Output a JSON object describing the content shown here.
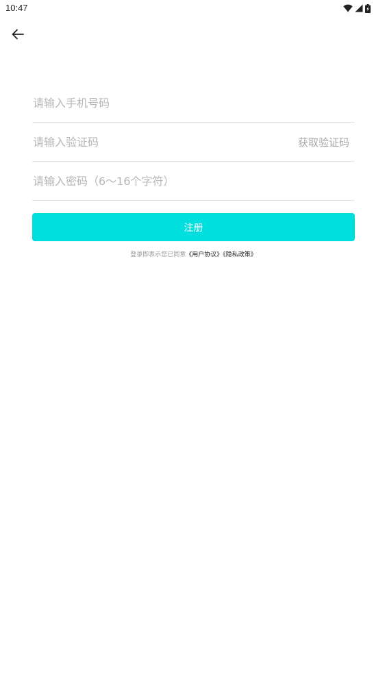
{
  "status_bar": {
    "time": "10:47",
    "icons": [
      "wifi-icon",
      "signal-icon",
      "battery-icon"
    ]
  },
  "nav": {
    "back_icon": "arrow-left-icon"
  },
  "form": {
    "phone_placeholder": "请输入手机号码",
    "code_placeholder": "请输入验证码",
    "get_code_label": "获取验证码",
    "password_placeholder": "请输入密码（6～16个字符）"
  },
  "submit": {
    "label": "注册"
  },
  "agreement": {
    "prefix": "登录即表示您已同意",
    "user_agreement": "《用户协议》",
    "privacy_policy": "《隐私政策》"
  },
  "colors": {
    "accent": "#00dede",
    "placeholder": "#b6b6b6",
    "divider": "#e3e3e3"
  }
}
